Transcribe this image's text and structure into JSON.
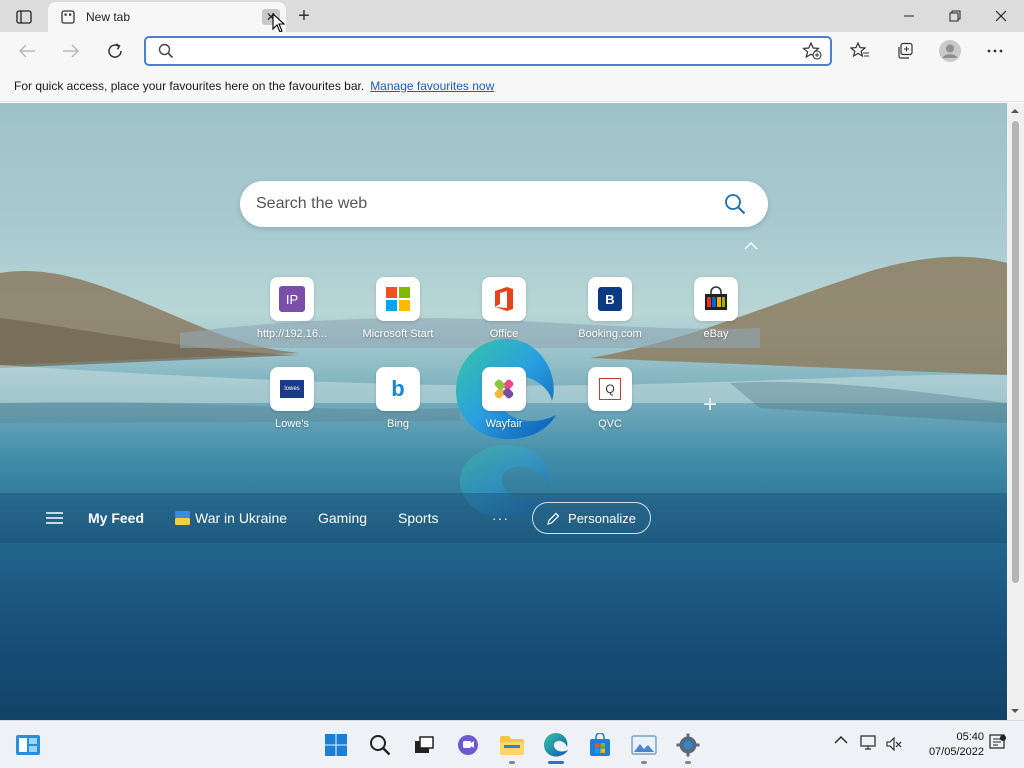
{
  "window": {
    "tab_title": "New tab",
    "tab_close_glyph": "✕",
    "new_tab_glyph": "+"
  },
  "toolbar": {
    "address_value": "",
    "address_placeholder": ""
  },
  "favourites_bar": {
    "message": "For quick access, place your favourites here on the favourites bar.",
    "link": "Manage favourites now"
  },
  "newtab": {
    "search_placeholder": "Search the web",
    "tiles": [
      {
        "label": "http://192.16...",
        "icon": "ip-icon"
      },
      {
        "label": "Microsoft Start",
        "icon": "microsoft-start-icon"
      },
      {
        "label": "Office",
        "icon": "office-icon"
      },
      {
        "label": "Booking.com",
        "icon": "booking-icon"
      },
      {
        "label": "eBay",
        "icon": "ebay-icon"
      },
      {
        "label": "Lowe's",
        "icon": "lowes-icon"
      },
      {
        "label": "Bing",
        "icon": "bing-icon"
      },
      {
        "label": "Wayfair",
        "icon": "wayfair-icon"
      },
      {
        "label": "QVC",
        "icon": "qvc-icon"
      }
    ],
    "tile_ip_text": "IP",
    "tile_booking_text": "B",
    "tile_bing_text": "b",
    "tile_qvc_text": "Q",
    "tile_lowes_text": "lowes",
    "add_glyph": "+"
  },
  "feed": {
    "items": [
      "My Feed",
      "War in Ukraine",
      "Gaming",
      "Sports"
    ],
    "more": "···",
    "personalize": "Personalize"
  },
  "taskbar": {
    "time": "05:40",
    "date": "07/05/2022"
  },
  "colors": {
    "accent": "#2a6ed8",
    "address_border": "#4a7fd4",
    "link": "#1a5fb4"
  }
}
